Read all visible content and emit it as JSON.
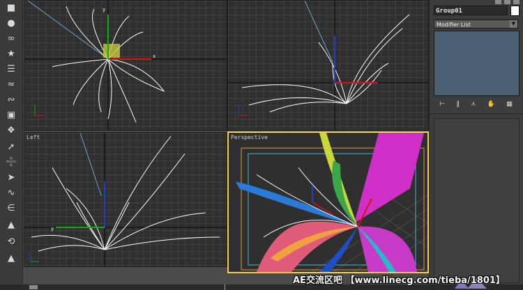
{
  "panel": {
    "object_name": "Group01",
    "modifier_list": "Modifier List",
    "stack_tool_icons": [
      "pin-stack-icon",
      "show-end-result-icon",
      "make-unique-icon",
      "remove-modifier-icon",
      "configure-sets-icon"
    ]
  },
  "viewports": {
    "top_label": "",
    "front_label": "",
    "left_label": "Left",
    "perspective_label": "Perspective"
  },
  "toolbar_icons": [
    "box-icon",
    "sphere-icon",
    "helix-icon",
    "star-icon",
    "line-icon",
    "wave-icon",
    "spline-icon",
    "cylinder-icon",
    "bone-icon",
    "arrow-icon",
    "link-icon",
    "bend-icon",
    "spring-icon",
    "twist-icon",
    "noise-icon",
    "rotate-icon",
    "scale-icon"
  ],
  "colors": {
    "viewport_bg": "#2f2f2f",
    "grid": "#575757",
    "active_border": "#f2d04b",
    "wire": "#ffffff",
    "stack_bg": "#4d5f73"
  },
  "watermark": {
    "text": "AE交流区吧 【www.linecg.com/tieba/1801】"
  }
}
